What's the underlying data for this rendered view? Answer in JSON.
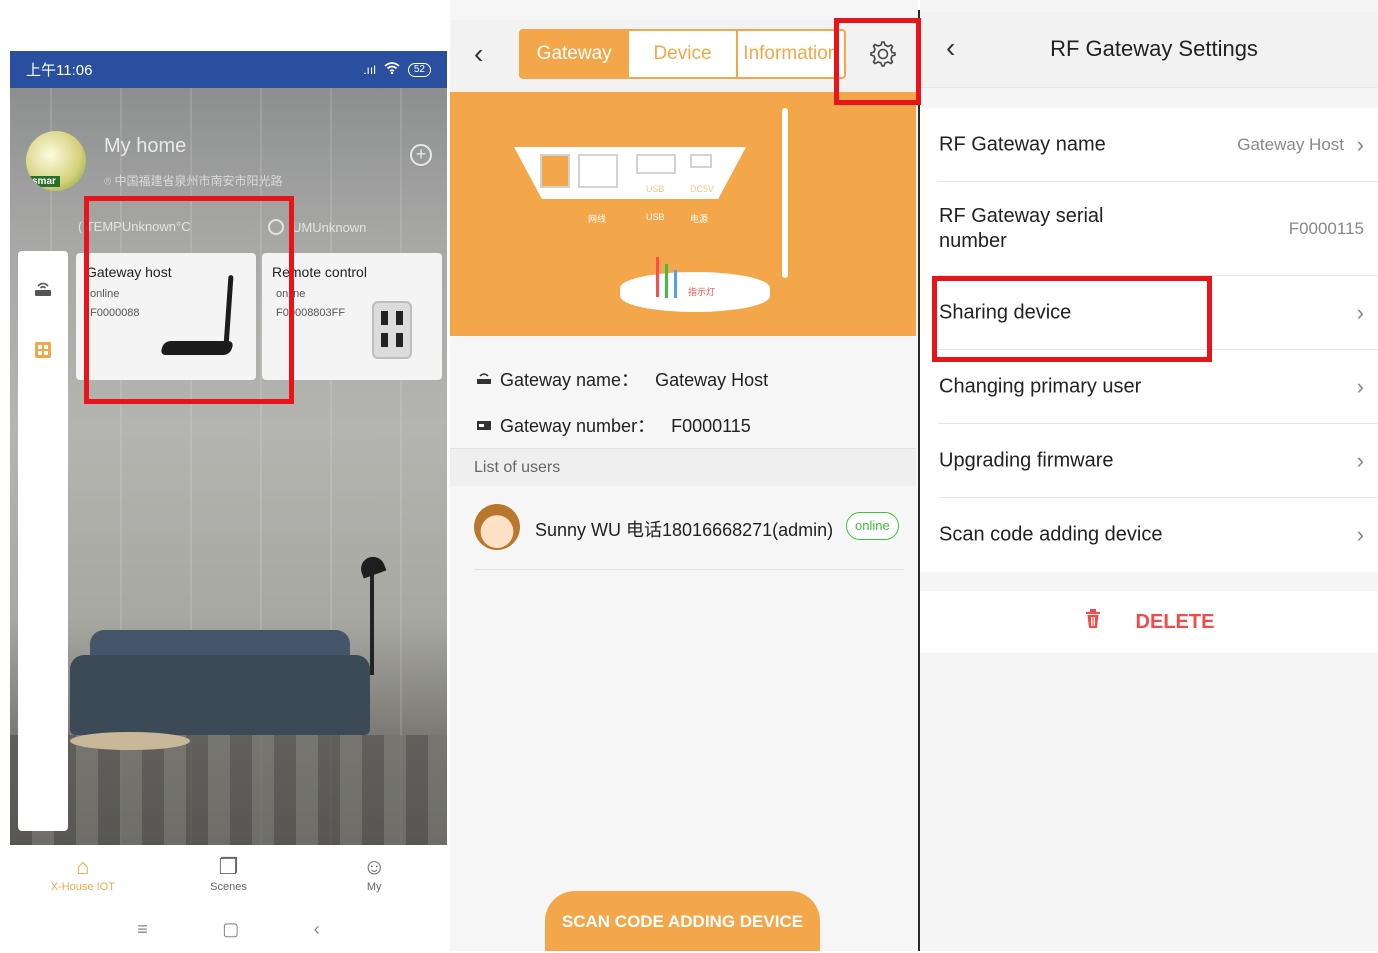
{
  "panel1": {
    "status_time": "上午11:06",
    "status_signal": ".ııl",
    "status_battery": "52",
    "home_title": "My home",
    "home_address": "中国福建省泉州市南安市阳光路",
    "add_icon": "plus-circle-icon",
    "temperature": "TEMPUnknown°C",
    "humidity": "UMUnknown",
    "avatar_text": "smar",
    "cards": [
      {
        "title": "Gateway host",
        "status": "online",
        "id": "F0000088"
      },
      {
        "title": "Remote control",
        "status": "online",
        "id": "F00008803FF"
      }
    ],
    "tabs": [
      {
        "label": "X-House IOT",
        "icon": "home-icon"
      },
      {
        "label": "Scenes",
        "icon": "scenes-icon"
      },
      {
        "label": "My",
        "icon": "user-icon"
      }
    ],
    "nav": [
      "≡",
      "▢",
      "‹"
    ],
    "accent": "#f3a74a",
    "statusbar_color": "#2a4f9e"
  },
  "panel2": {
    "tabs": [
      "Gateway",
      "Device",
      "Information"
    ],
    "active_tab": "Gateway",
    "hero_labels": [
      "网线",
      "USB",
      "电源",
      "USB",
      "DC5V",
      "指示灯"
    ],
    "gateway_name_label": "Gateway name：",
    "gateway_name_value": "Gateway Host",
    "gateway_number_label": "Gateway number：",
    "gateway_number_value": "F0000115",
    "list_header": "List of users",
    "user_name": "Sunny WU 电话18016668271(admin)",
    "user_status": "online",
    "scan_button": "SCAN CODE ADDING DEVICE",
    "online_color": "#3fbf3f"
  },
  "panel3": {
    "title": "RF Gateway Settings",
    "rows": [
      {
        "label": "RF Gateway name",
        "value": "Gateway Host",
        "arrow": true
      },
      {
        "label": "RF Gateway serial number",
        "value": "F0000115",
        "arrow": false
      },
      {
        "label": "Sharing device",
        "value": "",
        "arrow": true
      },
      {
        "label": "Changing primary user",
        "value": "",
        "arrow": true
      },
      {
        "label": "Upgrading firmware",
        "value": "",
        "arrow": true
      },
      {
        "label": "Scan code adding device",
        "value": "",
        "arrow": true
      }
    ],
    "delete_label": "DELETE",
    "delete_color": "#f24b4b"
  }
}
